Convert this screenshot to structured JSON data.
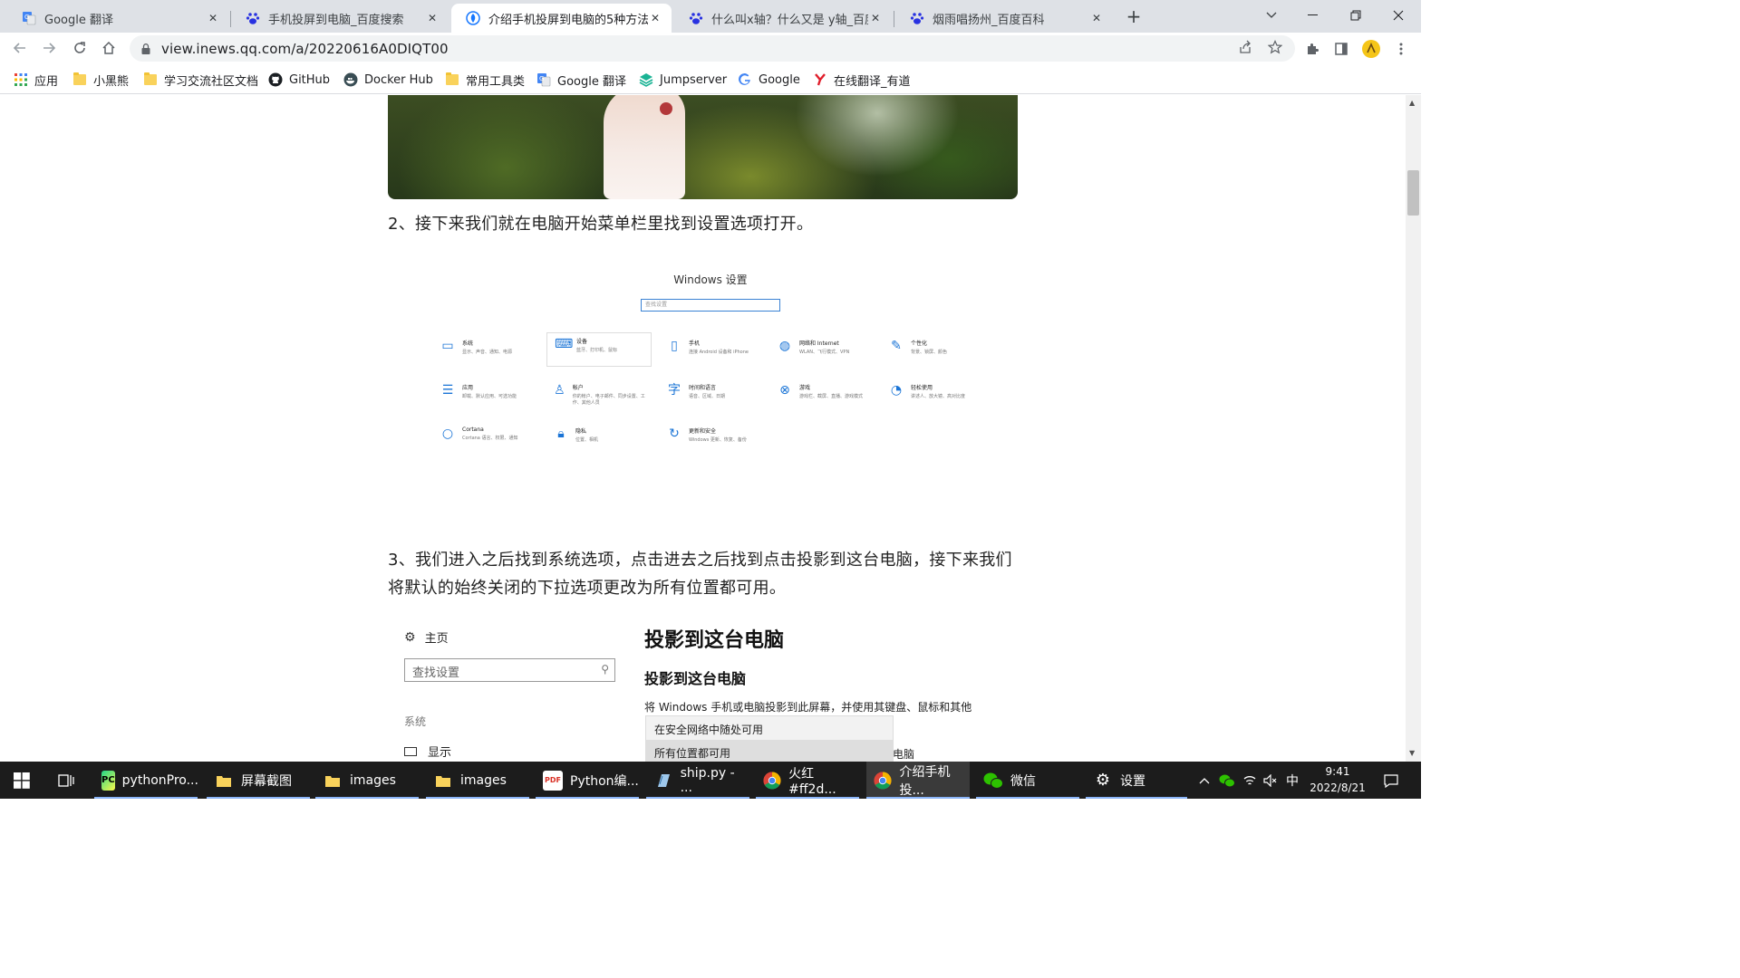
{
  "browser": {
    "tabs": [
      {
        "title": "Google 翻译",
        "favicon": "google-translate-icon",
        "active": false
      },
      {
        "title": "手机投屏到电脑_百度搜索",
        "favicon": "baidu-paw-icon",
        "active": false
      },
      {
        "title": "介绍手机投屏到电脑的5种方法",
        "favicon": "qq-news-icon",
        "active": true
      },
      {
        "title": "什么叫x轴？什么又是 y轴_百度知",
        "favicon": "baidu-paw-icon",
        "active": false
      },
      {
        "title": "烟雨唱扬州_百度百科",
        "favicon": "baidu-paw-icon",
        "active": false
      }
    ],
    "url": "view.inews.qq.com/a/20220616A0DIQT00",
    "bookmarks": [
      {
        "label": "应用",
        "icon": "apps-grid-icon"
      },
      {
        "label": "小黑熊",
        "icon": "folder-icon"
      },
      {
        "label": "学习交流社区文档",
        "icon": "folder-icon"
      },
      {
        "label": "GitHub",
        "icon": "github-icon"
      },
      {
        "label": "Docker Hub",
        "icon": "docker-icon"
      },
      {
        "label": "常用工具类",
        "icon": "folder-icon"
      },
      {
        "label": "Google 翻译",
        "icon": "google-translate-icon"
      },
      {
        "label": "Jumpserver",
        "icon": "jumpserver-icon"
      },
      {
        "label": "Google",
        "icon": "google-icon"
      },
      {
        "label": "在线翻译_有道",
        "icon": "youdao-icon"
      }
    ]
  },
  "article": {
    "step2": "2、接下来我们就在电脑开始菜单栏里找到设置选项打开。",
    "step3": "3、我们进入之后找到系统选项，点击进去之后找到点击投影到这台电脑，接下来我们将默认的始终关闭的下拉选项更改为所有位置都可用。",
    "windows_settings": {
      "title": "Windows 设置",
      "search_placeholder": "查找设置",
      "items": [
        {
          "name": "系统",
          "desc": "显示、声音、通知、电源",
          "icon": "laptop-icon"
        },
        {
          "name": "设备",
          "desc": "蓝牙、打印机、鼠标",
          "icon": "keyboard-icon"
        },
        {
          "name": "手机",
          "desc": "连接 Android 设备和 iPhone",
          "icon": "phone-icon"
        },
        {
          "name": "网络和 Internet",
          "desc": "WLAN、飞行模式、VPN",
          "icon": "globe-icon"
        },
        {
          "name": "个性化",
          "desc": "背景、锁屏、颜色",
          "icon": "paint-icon"
        },
        {
          "name": "应用",
          "desc": "卸载、默认应用、可选功能",
          "icon": "apps-list-icon"
        },
        {
          "name": "帐户",
          "desc": "你的帐户、电子邮件、同步设置、工作、其他人员",
          "icon": "person-icon"
        },
        {
          "name": "时间和语言",
          "desc": "语音、区域、日期",
          "icon": "time-language-icon"
        },
        {
          "name": "游戏",
          "desc": "游戏栏、截屏、直播、游戏模式",
          "icon": "xbox-icon"
        },
        {
          "name": "轻松使用",
          "desc": "讲述人、放大镜、高对比度",
          "icon": "ease-of-access-icon"
        },
        {
          "name": "Cortana",
          "desc": "Cortana 语言、权限、通知",
          "icon": "cortana-icon"
        },
        {
          "name": "隐私",
          "desc": "位置、相机",
          "icon": "lock-icon"
        },
        {
          "name": "更新和安全",
          "desc": "Windows 更新、恢复、备份",
          "icon": "update-icon"
        }
      ]
    },
    "projection_settings": {
      "home": "主页",
      "search_placeholder": "查找设置",
      "category": "系统",
      "display": "显示",
      "heading": "投影到这台电脑",
      "subheading": "投影到这台电脑",
      "description": "将 Windows 手机或电脑投影到此屏幕，并使用其键盘、鼠标和其他",
      "options": [
        "在安全网络中随处可用",
        "所有位置都可用"
      ],
      "selected_option": "所有位置都可用",
      "trailing": "电脑"
    }
  },
  "taskbar": {
    "apps": [
      {
        "label": "pythonPro...",
        "icon": "pycharm-icon"
      },
      {
        "label": "屏幕截图",
        "icon": "folder-icon"
      },
      {
        "label": "images",
        "icon": "folder-icon"
      },
      {
        "label": "images",
        "icon": "folder-icon"
      },
      {
        "label": "Python编...",
        "icon": "pdf-icon"
      },
      {
        "label": "ship.py - ...",
        "icon": "editor-icon"
      },
      {
        "label": "火红 #ff2d...",
        "icon": "chrome-icon"
      },
      {
        "label": "介绍手机投...",
        "icon": "chrome-icon"
      },
      {
        "label": "微信",
        "icon": "wechat-icon"
      },
      {
        "label": "设置",
        "icon": "gear-icon"
      }
    ],
    "ime": "中",
    "time": "9:41",
    "date": "2022/8/21"
  }
}
